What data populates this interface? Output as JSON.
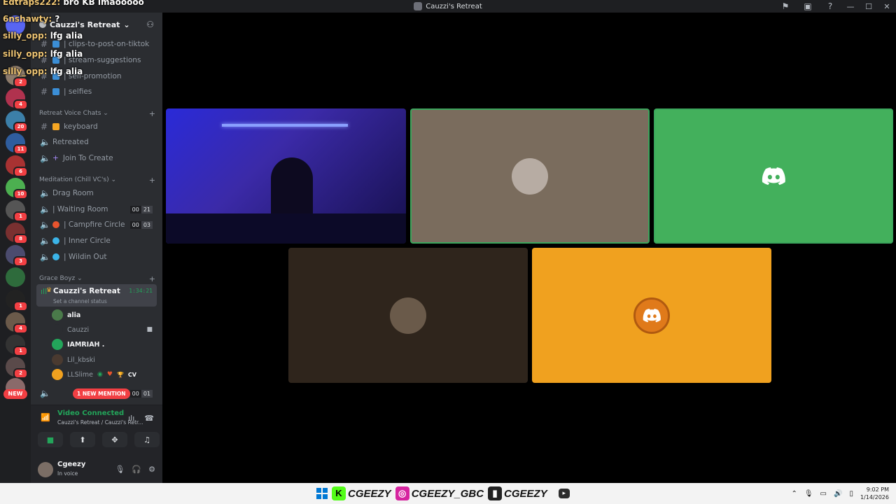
{
  "window": {
    "title": "Cauzzi's Retreat"
  },
  "server": {
    "name": "Cauzzi's Retreat"
  },
  "guild_badges": [
    "2",
    "4",
    "20",
    "11",
    "6",
    "10",
    "1",
    "8",
    "3",
    "1",
    "4",
    "1",
    "2"
  ],
  "guild_new_label": "NEW",
  "channels_top": [
    {
      "label": "| clips-to-post-on-tiktok"
    },
    {
      "label": "| stream-suggestions"
    },
    {
      "label": "| self-promotion"
    },
    {
      "label": "| selfies"
    }
  ],
  "categories": {
    "retreat_voice": "Retreat Voice Chats",
    "meditation": "Meditation (Chill VC's)",
    "grace_boyz": "Grace Boyz"
  },
  "retreat_channels": [
    {
      "label": "keyboard"
    },
    {
      "label": "Retreated"
    },
    {
      "label": "Join To Create"
    }
  ],
  "meditation_channels": [
    {
      "label": "Drag Room"
    },
    {
      "label": "| Waiting Room",
      "c1": "00",
      "c2": "21"
    },
    {
      "label": "| Campfire Circle",
      "c1": "00",
      "c2": "03"
    },
    {
      "label": "| Inner Circle"
    },
    {
      "label": "| Wildin Out"
    }
  ],
  "active_channel": {
    "name": "Cauzzi's Retreat",
    "timer": "1:34:21",
    "status": "Set a channel status"
  },
  "voice_users": [
    {
      "name": "alia"
    },
    {
      "name": "Cauzzi"
    },
    {
      "name": "IAMRIAH ."
    },
    {
      "name": "Lil_kbski"
    },
    {
      "name": "LLSlime",
      "tag": "CV"
    }
  ],
  "bottom_channel": {
    "c1": "00",
    "c2": "01"
  },
  "mention_pill": "1 NEW MENTION",
  "voice_panel": {
    "status": "Video Connected",
    "sub": "Cauzzi's Retreat / Cauzzi's Retr..."
  },
  "user_panel": {
    "name": "Cgeezy",
    "status": "In voice"
  },
  "chat_overlay": [
    {
      "user": "Edtraps222:",
      "msg": "bro KB lmaooooo"
    },
    {
      "user": "6nshawty:",
      "msg": "?"
    },
    {
      "user": "silly_opp:",
      "msg": "lfg alia"
    },
    {
      "user": "silly_opp:",
      "msg": "lfg alia"
    },
    {
      "user": "silly_opp:",
      "msg": "lfg alia"
    }
  ],
  "taskbar": {
    "kick": "CGEEZY",
    "instagram": "CGEEZY_GBC",
    "twitch": "CGEEZY",
    "time": "9:02 PM",
    "date": "1/14/2026"
  },
  "colors": {
    "tile_green": "#43b05c",
    "tile_taupe": "#7a6c5d",
    "tile_brown": "#2f251c",
    "tile_orange": "#f0a11f",
    "accent_green": "#23a55a",
    "mention_red": "#f23f43"
  }
}
